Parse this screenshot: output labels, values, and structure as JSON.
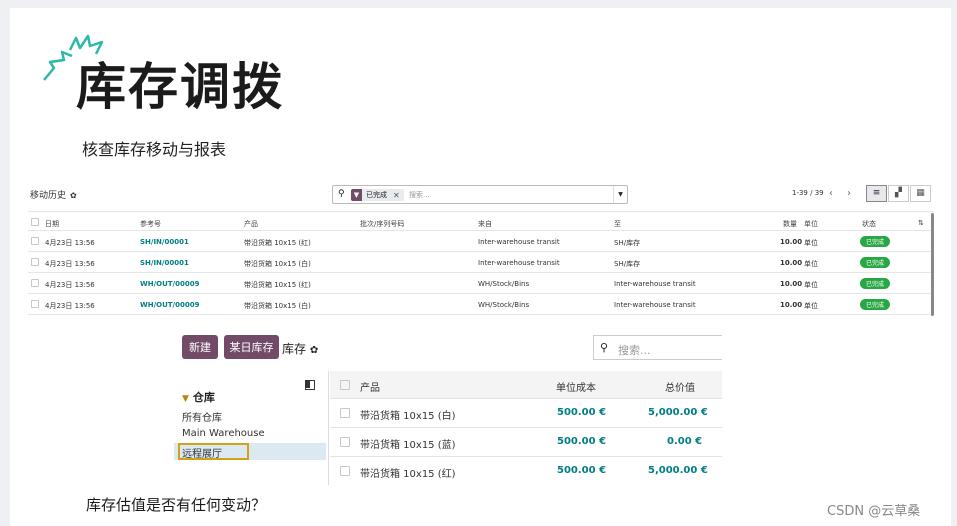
{
  "slide": {
    "title": "库存调拨",
    "subtitle": "核查库存移动与报表",
    "question": "库存估值是否有任何变动？",
    "watermark": "CSDN @云草桑"
  },
  "colors": {
    "brand": "#714b67",
    "link": "#017e84",
    "done_badge": "#28a745",
    "highlight": "#d4a017",
    "burst": "#2bb8a8"
  },
  "moves": {
    "title": "移动历史",
    "search": {
      "facet": "已完成",
      "placeholder": "搜索..."
    },
    "pager": "1-39 / 39",
    "columns": [
      "日期",
      "参考号",
      "产品",
      "批次/序列号码",
      "来自",
      "至",
      "数量",
      "单位",
      "状态"
    ],
    "rows": [
      {
        "date": "4月23日 13:56",
        "ref": "SH/IN/00001",
        "product": "带沿货箱 10x15 (红)",
        "from": "Inter-warehouse transit",
        "to": "SH/库存",
        "qty": "10.00",
        "unit": "单位",
        "status": "已完成"
      },
      {
        "date": "4月23日 13:56",
        "ref": "SH/IN/00001",
        "product": "带沿货箱 10x15 (白)",
        "from": "Inter-warehouse transit",
        "to": "SH/库存",
        "qty": "10.00",
        "unit": "单位",
        "status": "已完成"
      },
      {
        "date": "4月23日 13:56",
        "ref": "WH/OUT/00009",
        "product": "带沿货箱 10x15 (红)",
        "from": "WH/Stock/Bins",
        "to": "Inter-warehouse transit",
        "qty": "10.00",
        "unit": "单位",
        "status": "已完成"
      },
      {
        "date": "4月23日 13:56",
        "ref": "WH/OUT/00009",
        "product": "带沿货箱 10x15 (白)",
        "from": "WH/Stock/Bins",
        "to": "Inter-warehouse transit",
        "qty": "10.00",
        "unit": "单位",
        "status": "已完成"
      }
    ]
  },
  "valuation": {
    "new_button": "新建",
    "someday_button": "某日库存",
    "title": "库存",
    "search_placeholder": "搜索...",
    "sidebar": {
      "section": "仓库",
      "items": [
        "所有仓库",
        "Main Warehouse",
        "远程展厅"
      ]
    },
    "columns": [
      "产品",
      "单位成本",
      "总价值"
    ],
    "rows": [
      {
        "product": "带沿货箱 10x15 (白)",
        "unit_cost": "500.00 €",
        "total": "5,000.00 €"
      },
      {
        "product": "带沿货箱 10x15 (蓝)",
        "unit_cost": "500.00 €",
        "total": "0.00 €"
      },
      {
        "product": "带沿货箱 10x15 (红)",
        "unit_cost": "500.00 €",
        "total": "5,000.00 €"
      }
    ]
  }
}
